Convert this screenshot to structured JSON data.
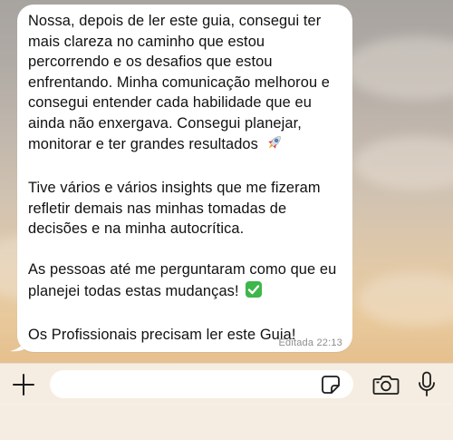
{
  "message": {
    "paragraphs": [
      "Nossa, depois de ler este guia, consegui ter mais clareza no caminho que estou percorrendo e os desafios que estou enfrentando. Minha comunicação melhorou e consegui entender cada habilidade que eu ainda não enxergava. Consegui planejar, monitorar e ter grandes resultados",
      "Tive vários e vários insights que me fizeram refletir demais nas minhas tomadas de decisões e na minha autocrítica.",
      "As pessoas até me perguntaram como que eu planejei todas estas mudanças!",
      "Os Profissionais precisam ler este Guia!"
    ],
    "emojis": [
      "rocket-emoji",
      "check-mark-button-emoji"
    ],
    "edited_label": "Editada",
    "time": "22:13"
  },
  "input_bar": {
    "text_value": "",
    "icons": [
      "plus-icon",
      "sticker-icon",
      "camera-icon",
      "microphone-icon"
    ]
  },
  "colors": {
    "bubble": "#ffffff",
    "text": "#111111",
    "meta": "#8e8e8e",
    "input_bar": "#f6f1e8",
    "check_green": "#3db64a"
  }
}
